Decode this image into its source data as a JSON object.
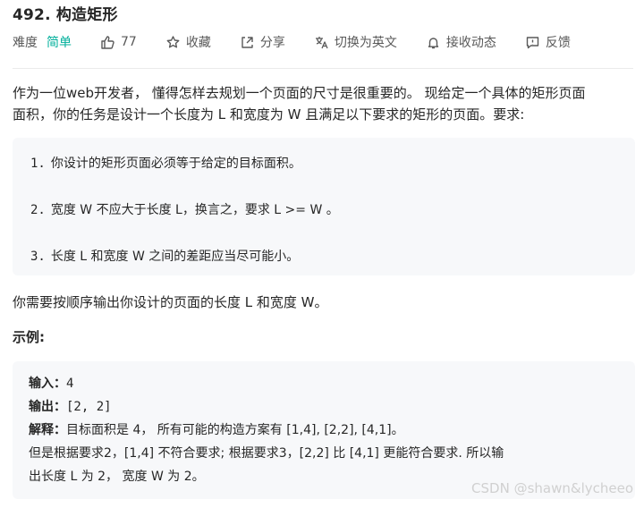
{
  "title": "492. 构造矩形",
  "toolbar": {
    "difficulty_label": "难度",
    "difficulty_value": "简单",
    "likes": "77",
    "favorite": "收藏",
    "share": "分享",
    "switch_lang": "切换为英文",
    "subscribe": "接收动态",
    "feedback": "反馈"
  },
  "description": {
    "line1": "作为一位web开发者， 懂得怎样去规划一个页面的尺寸是很重要的。 现给定一个具体的矩形页面",
    "line2": "面积，你的任务是设计一个长度为 L 和宽度为 W 且满足以下要求的矩形的页面。要求:"
  },
  "requirements": [
    {
      "num": "1.",
      "text": "你设计的矩形页面必须等于给定的目标面积。"
    },
    {
      "num": "2.",
      "text": "宽度 W 不应大于长度 L，换言之，要求 L >= W 。"
    },
    {
      "num": "3.",
      "text": "长度 L 和宽度 W 之间的差距应当尽可能小。"
    }
  ],
  "output_desc": "你需要按顺序输出你设计的页面的长度 L 和宽度 W。",
  "example_label": "示例:",
  "example": {
    "input_key": "输入：",
    "input_val": "4",
    "output_key": "输出：",
    "output_val": "[2, 2]",
    "explain_key": "解释：",
    "explain_1": "目标面积是 4， 所有可能的构造方案有 [1,4], [2,2], [4,1]。",
    "explain_2": "但是根据要求2，[1,4] 不符合要求; 根据要求3，[2,2] 比 [4,1] 更能符合要求. 所以输",
    "explain_3": "出长度 L 为 2， 宽度 W 为 2。"
  },
  "watermark": "CSDN @shawn&lycheeo",
  "colors": {
    "easy": "#00af9b",
    "text": "#262626",
    "muted": "#595959",
    "box_bg": "#f7f8fa"
  },
  "icons": [
    "thumbs-up-icon",
    "star-icon",
    "share-icon",
    "translate-icon",
    "bell-icon",
    "feedback-icon"
  ]
}
